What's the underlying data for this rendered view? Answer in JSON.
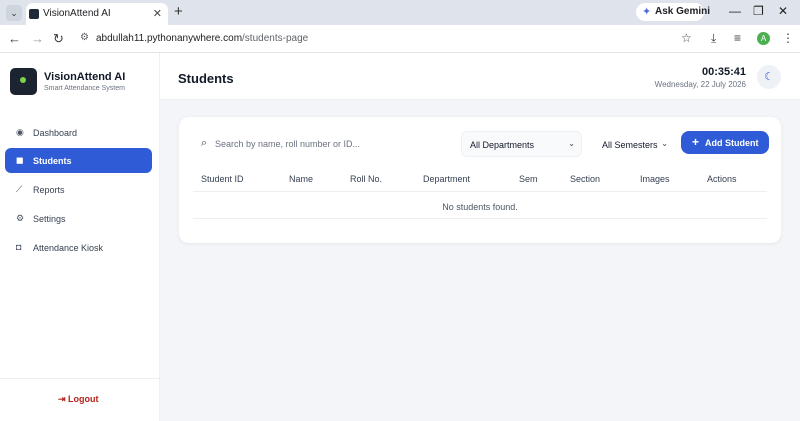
{
  "browser": {
    "tab_title": "VisionAttend AI",
    "gemini_label": "Ask Gemini",
    "url_host": "abdullah11.pythonanywhere.com",
    "url_path": "/students-page",
    "profile_initial": "A"
  },
  "app": {
    "name": "VisionAttend AI",
    "subtitle": "Smart Attendance System"
  },
  "sidebar": {
    "items": [
      {
        "label": "Dashboard",
        "icon": "gauge-icon",
        "active": false
      },
      {
        "label": "Students",
        "icon": "users-icon",
        "active": true
      },
      {
        "label": "Reports",
        "icon": "chart-line-icon",
        "active": false
      },
      {
        "label": "Settings",
        "icon": "gear-icon",
        "active": false
      },
      {
        "label": "Attendance Kiosk",
        "icon": "camera-icon",
        "active": false
      }
    ],
    "logout_label": "Logout"
  },
  "header": {
    "title": "Students",
    "time": "00:35:41",
    "date": "Wednesday, 22 July 2026"
  },
  "toolbar": {
    "search_placeholder": "Search by name, roll number or ID...",
    "department_value": "All Departments",
    "semester_value": "All Semesters",
    "add_label": "Add Student"
  },
  "table": {
    "columns": [
      "Student ID",
      "Name",
      "Roll No.",
      "Department",
      "Sem",
      "Section",
      "Images",
      "Actions"
    ],
    "empty_message": "No students found."
  },
  "colors": {
    "accent": "#2f5bd6",
    "logout": "#b42318",
    "background": "#f4f5f8"
  }
}
